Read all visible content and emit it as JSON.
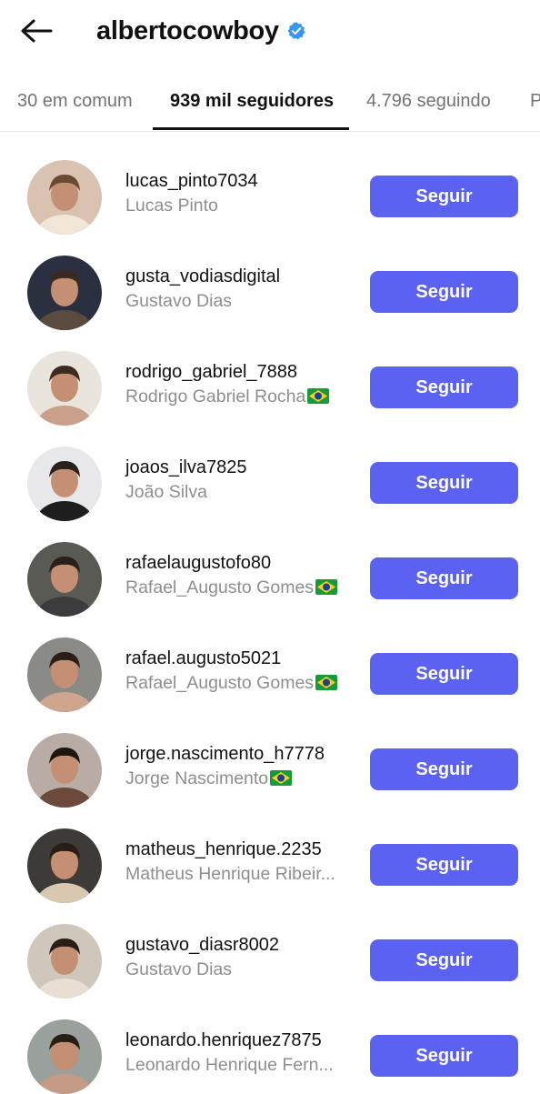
{
  "header": {
    "title": "albertocowboy",
    "back_icon": "arrow-left-icon",
    "verified_icon": "verified-badge-icon",
    "verified_color": "#3897f0"
  },
  "tabs": [
    {
      "label": "30 em comum",
      "active": false
    },
    {
      "label": "939 mil seguidores",
      "active": true
    },
    {
      "label": "4.796 seguindo",
      "active": false
    },
    {
      "label": "P",
      "active": false
    }
  ],
  "accent_color": "#5b61f0",
  "users": [
    {
      "username": "lucas_pinto7034",
      "name": "Lucas Pinto",
      "flag": false,
      "button": "Seguir"
    },
    {
      "username": "gusta_vodiasdigital",
      "name": "Gustavo Dias",
      "flag": false,
      "button": "Seguir"
    },
    {
      "username": "rodrigo_gabriel_7888",
      "name": "Rodrigo Gabriel Rocha",
      "flag": true,
      "button": "Seguir"
    },
    {
      "username": "joaos_ilva7825",
      "name": "João Silva",
      "flag": false,
      "button": "Seguir"
    },
    {
      "username": "rafaelaugustofo80",
      "name": "Rafael_Augusto Gomes",
      "flag": true,
      "button": "Seguir"
    },
    {
      "username": "rafael.augusto5021",
      "name": "Rafael_Augusto Gomes",
      "flag": true,
      "button": "Seguir"
    },
    {
      "username": "jorge.nascimento_h7778",
      "name": "Jorge Nascimento",
      "flag": true,
      "button": "Seguir"
    },
    {
      "username": "matheus_henrique.2235",
      "name": "Matheus Henrique Ribeir...",
      "flag": false,
      "button": "Seguir"
    },
    {
      "username": "gustavo_diasr8002",
      "name": "Gustavo Dias",
      "flag": false,
      "button": "Seguir"
    },
    {
      "username": "leonardo.henriquez7875",
      "name": "Leonardo Henrique Fern...",
      "flag": false,
      "button": "Seguir"
    }
  ]
}
